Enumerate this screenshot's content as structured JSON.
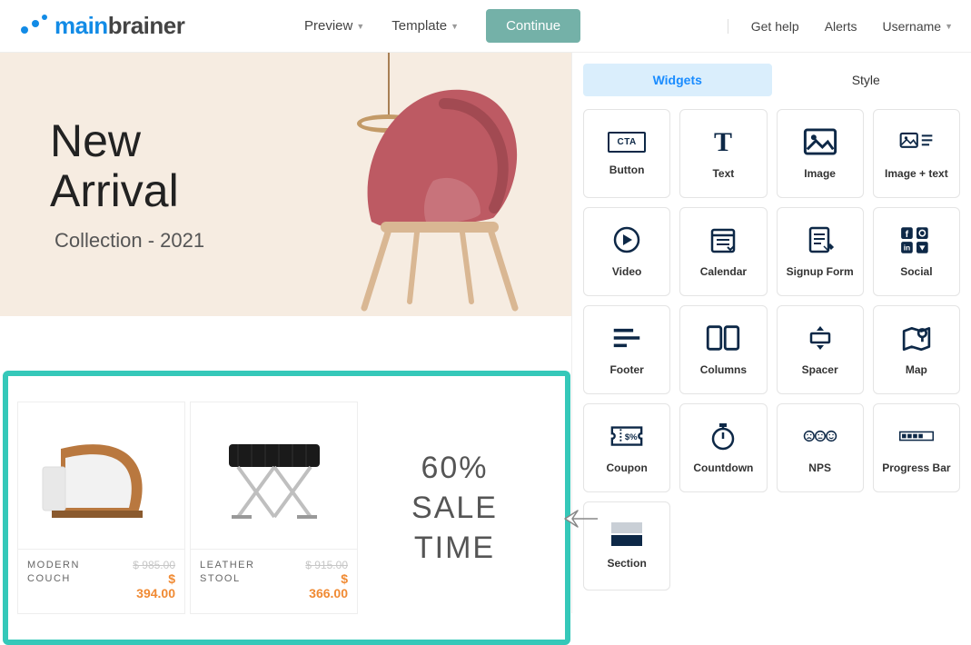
{
  "brand": {
    "part1": "main",
    "part2": "brainer"
  },
  "nav": {
    "preview": "Preview",
    "template": "Template",
    "continue": "Continue",
    "help": "Get help",
    "alerts": "Alerts",
    "user": "Username"
  },
  "hero": {
    "title_line1": "New",
    "title_line2": "Arrival",
    "subtitle": "Collection - 2021"
  },
  "products": [
    {
      "name": "MODERN COUCH",
      "old_price": "$ 985.00",
      "new_price": "$ 394.00"
    },
    {
      "name": "LEATHER STOOL",
      "old_price": "$ 915.00",
      "new_price": "$ 366.00"
    }
  ],
  "sale": {
    "line1": "60%",
    "line2": "SALE",
    "line3": "TIME"
  },
  "panel": {
    "tab1": "Widgets",
    "tab2": "Style"
  },
  "widgets": {
    "button_cta": "CTA",
    "button": "Button",
    "text": "Text",
    "image": "Image",
    "image_text": "Image + text",
    "video": "Video",
    "calendar": "Calendar",
    "signup": "Signup Form",
    "social": "Social",
    "footer": "Footer",
    "columns": "Columns",
    "spacer": "Spacer",
    "map": "Map",
    "coupon": "Coupon",
    "countdown": "Countdown",
    "nps": "NPS",
    "progress": "Progress Bar",
    "section": "Section"
  }
}
